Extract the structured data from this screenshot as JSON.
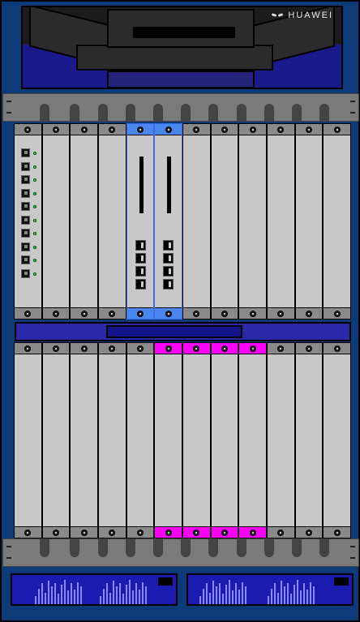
{
  "header": {
    "brand": "HUAWEI",
    "logo_icon": "huawei-logo-icon"
  },
  "colors": {
    "chassis": "#0d3a78",
    "card": "#c8c8c8",
    "card_cap": "#8a8a8a",
    "selected_blue": "#4a86f0",
    "selected_magenta": "#ff00ff",
    "led_green": "#3fd33f",
    "psu": "#1b1bb0"
  },
  "upper_shelf": {
    "slot_count": 12,
    "selected_slots": [
      5,
      6
    ],
    "interface_card_slot": 1,
    "interface_ports": 10,
    "control_card_slots": [
      5,
      6
    ],
    "control_card_ports": 4
  },
  "lower_shelf": {
    "slot_count": 12,
    "selected_slots": [
      6,
      7,
      8,
      9
    ]
  },
  "power_supplies": 2
}
